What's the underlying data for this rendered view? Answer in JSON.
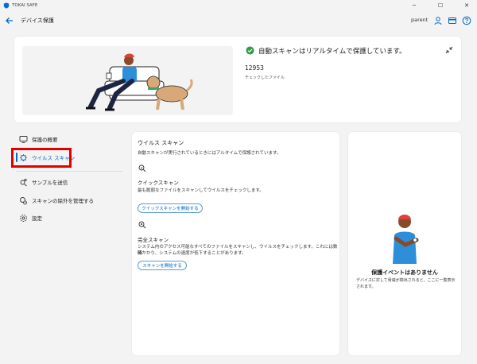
{
  "titlebar": {
    "app_name": "TOKAI SAFE",
    "minimize": "─",
    "maximize": "☐",
    "close": "✕"
  },
  "header": {
    "back_icon": "back-arrow-icon",
    "title": "デバイス保護",
    "user": "parent",
    "icons": [
      "person-icon",
      "card-icon",
      "help-icon"
    ]
  },
  "hero": {
    "status": "自動スキャンはリアルタイムで保護しています。",
    "file_count": "12953",
    "file_count_label": "チェックしたファイル"
  },
  "sidebar": {
    "items": [
      {
        "label": "保護の概要",
        "icon": "monitor-icon"
      },
      {
        "label": "ウイルス スキャン",
        "icon": "virus-scan-icon"
      },
      {
        "label": "サンプルを送信",
        "icon": "sample-icon"
      },
      {
        "label": "スキャンの除外を管理する",
        "icon": "exclusion-icon"
      },
      {
        "label": "設定",
        "icon": "gear-icon"
      }
    ]
  },
  "scan": {
    "title": "ウイルス スキャン",
    "description": "自動スキャンが実行されているときにはアルタイムで保護されています。",
    "quick": {
      "title": "クイックスキャン",
      "description": "最も脆弱なファイルをスキャンしてウイルスをチェックします。",
      "button": "クイックスキャンを開始する"
    },
    "full": {
      "title": "完全スキャン",
      "description_line1": "システム内のアクセス可能なすべてのファイルをスキャンし、ウイルスをチェックします。これには数時",
      "description_line2": "間かかり、システムの速度が低下することがあります。",
      "button": "スキャンを開始する"
    }
  },
  "events": {
    "title": "保護イベントはありません",
    "description": "デバイスに対して脅威が検出されると、ここに一覧表示されます。"
  },
  "colors": {
    "accent": "#0067c0",
    "success": "#2e9e4a",
    "highlight_box": "#e00000"
  }
}
